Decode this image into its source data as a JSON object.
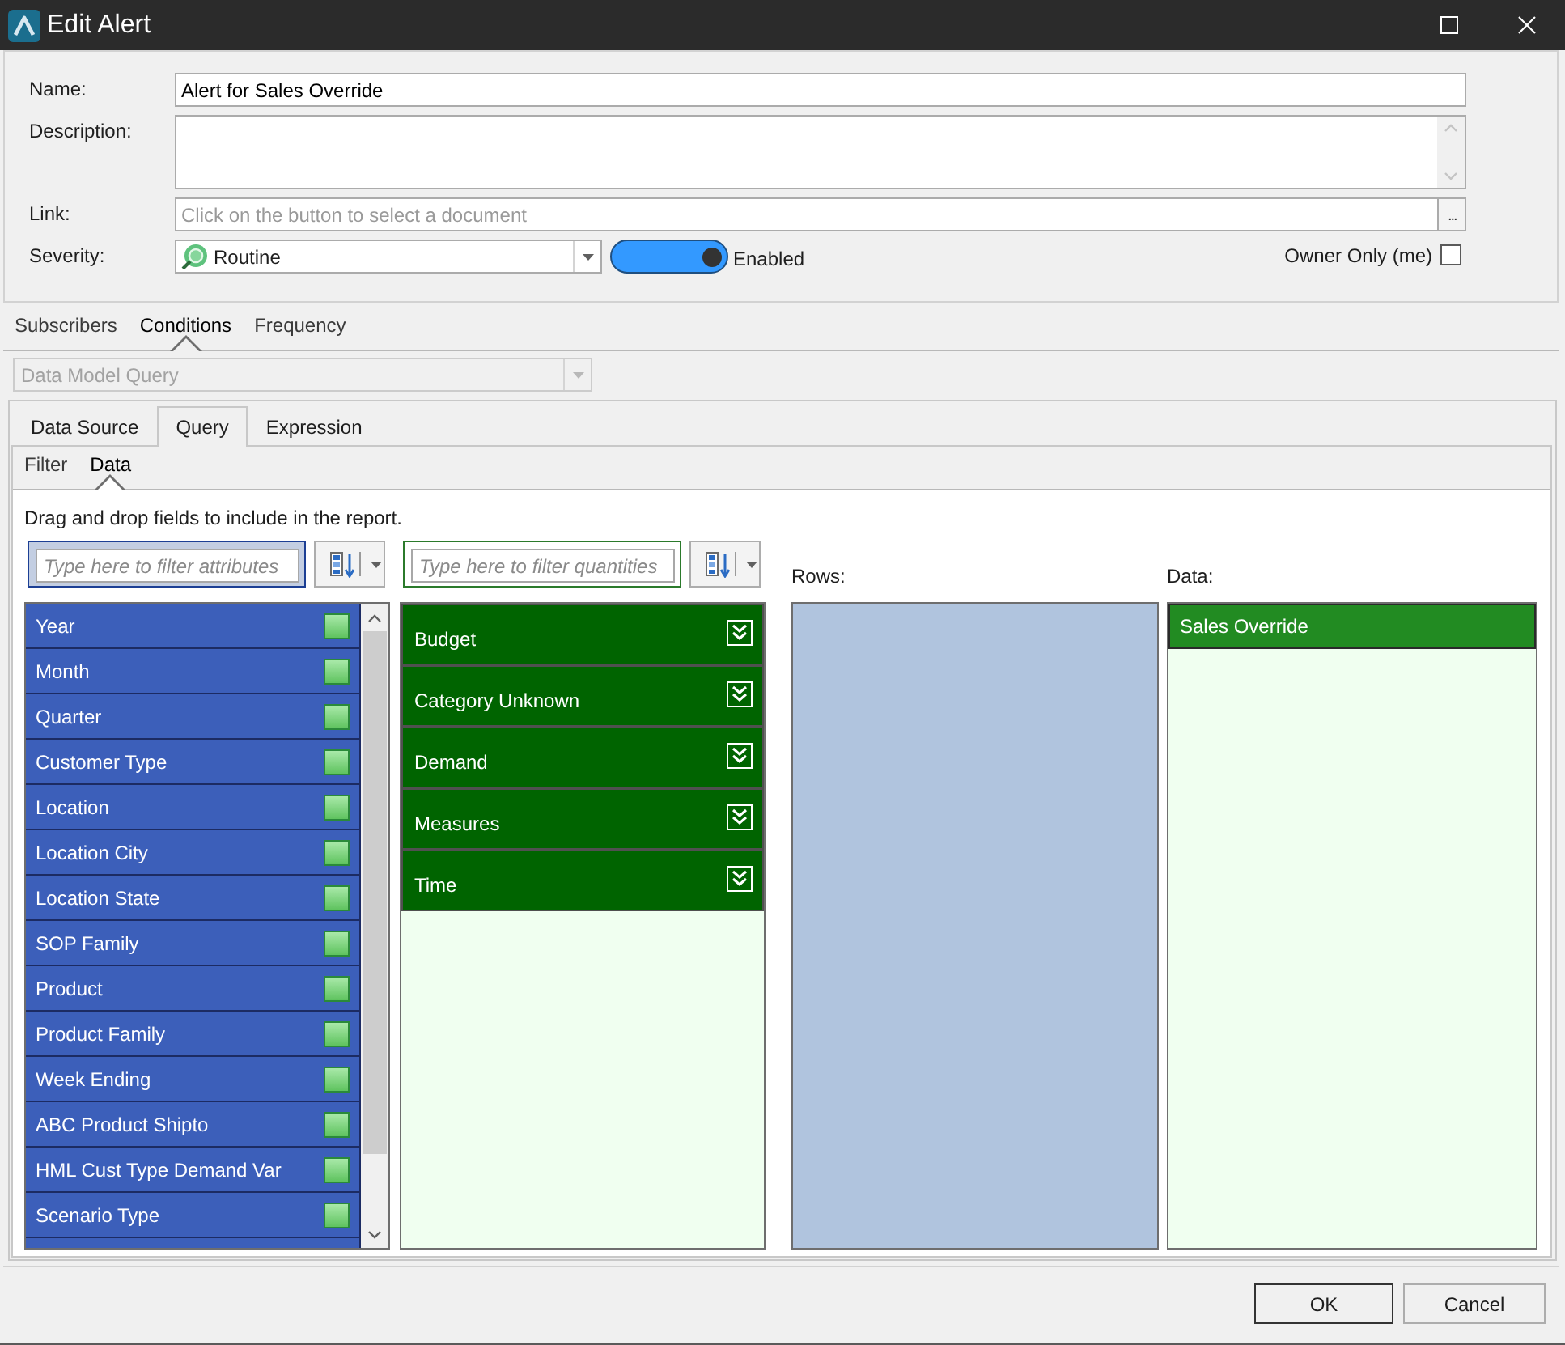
{
  "window": {
    "title": "Edit Alert"
  },
  "form": {
    "name": {
      "label": "Name:",
      "value": "Alert for Sales Override"
    },
    "description": {
      "label": "Description:"
    },
    "link": {
      "label": "Link:",
      "placeholder": "Click on the button to select a document",
      "browse_button": "..."
    },
    "severity": {
      "label": "Severity:",
      "value": "Routine"
    },
    "enabled": {
      "label": "Enabled",
      "on": true
    },
    "owner_only": {
      "label": "Owner Only (me)",
      "checked": false
    }
  },
  "tabs": [
    {
      "label": "Subscribers",
      "selected": false
    },
    {
      "label": "Conditions",
      "selected": true
    },
    {
      "label": "Frequency",
      "selected": false
    }
  ],
  "condition_type": {
    "value": "Data Model Query",
    "disabled": true
  },
  "condition_tabs": [
    {
      "label": "Data Source",
      "selected": false
    },
    {
      "label": "Query",
      "selected": true
    },
    {
      "label": "Expression",
      "selected": false
    }
  ],
  "query_tabs": [
    {
      "label": "Filter",
      "selected": false
    },
    {
      "label": "Data",
      "selected": true
    }
  ],
  "data_view": {
    "instructions": "Drag and drop fields to include in the report.",
    "attribute_filter": {
      "placeholder": "Type here to filter attributes"
    },
    "quantity_filter": {
      "placeholder": "Type here to filter quantities"
    },
    "attributes": [
      {
        "name": "Year"
      },
      {
        "name": "Month"
      },
      {
        "name": "Quarter"
      },
      {
        "name": "Customer Type"
      },
      {
        "name": "Location"
      },
      {
        "name": "Location City"
      },
      {
        "name": "Location State"
      },
      {
        "name": "SOP Family"
      },
      {
        "name": "Product"
      },
      {
        "name": "Product Family"
      },
      {
        "name": "Week Ending"
      },
      {
        "name": "ABC Product Shipto"
      },
      {
        "name": "HML Cust Type Demand Var"
      },
      {
        "name": "Scenario Type"
      }
    ],
    "quantities": [
      {
        "name": "Budget"
      },
      {
        "name": "Category Unknown"
      },
      {
        "name": "Demand"
      },
      {
        "name": "Measures"
      },
      {
        "name": "Time"
      }
    ],
    "rows": {
      "label": "Rows:"
    },
    "data": {
      "label": "Data:",
      "items": [
        {
          "name": "Sales Override"
        }
      ]
    }
  },
  "buttons": [
    {
      "label": "OK",
      "kind": "default"
    },
    {
      "label": "Cancel",
      "kind": "normal"
    }
  ]
}
